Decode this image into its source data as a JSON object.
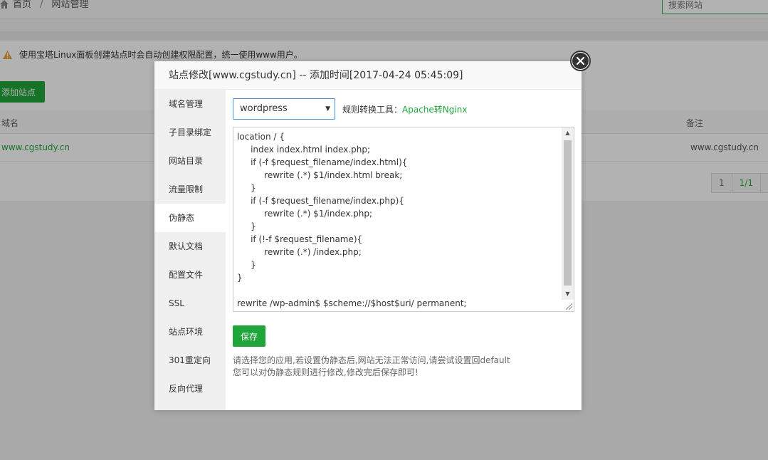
{
  "breadcrumb": {
    "home": "首页",
    "separator": "/",
    "current": "网站管理"
  },
  "search": {
    "placeholder": "搜索网站"
  },
  "alert": {
    "text": "使用宝塔Linux面板创建站点时会自动创建权限配置，统一使用www用户。"
  },
  "toolbar": {
    "add_site_label": "添加站点"
  },
  "table": {
    "columns": [
      "域名",
      "备注"
    ],
    "rows": [
      {
        "domain": "www.cgstudy.cn",
        "remark": "www.cgstudy.cn"
      }
    ]
  },
  "pagination": {
    "page": "1",
    "total": "1/1"
  },
  "modal": {
    "title": "站点修改[www.cgstudy.cn] -- 添加时间[2017-04-24 05:45:09]",
    "sidebar": [
      {
        "label": "域名管理",
        "active": false
      },
      {
        "label": "子目录绑定",
        "active": false
      },
      {
        "label": "网站目录",
        "active": false
      },
      {
        "label": "流量限制",
        "active": false
      },
      {
        "label": "伪静态",
        "active": true
      },
      {
        "label": "默认文档",
        "active": false
      },
      {
        "label": "配置文件",
        "active": false
      },
      {
        "label": "SSL",
        "active": false
      },
      {
        "label": "站点环境",
        "active": false
      },
      {
        "label": "301重定向",
        "active": false
      },
      {
        "label": "反向代理",
        "active": false
      }
    ],
    "rewrite": {
      "selected_rule": "wordpress",
      "tool_label": "规则转换工具：",
      "tool_link": "Apache转Nginx",
      "code": "location / {\n\tindex index.html index.php;\n\tif (-f $request_filename/index.html){\n\t\trewrite (.*) $1/index.html break;\n\t}\n\tif (-f $request_filename/index.php){\n\t\trewrite (.*) $1/index.php;\n\t}\n\tif (!-f $request_filename){\n\t\trewrite (.*) /index.php;\n\t}\n}\n\nrewrite /wp-admin$ $scheme://$host$uri/ permanent;",
      "save_label": "保存",
      "tip_line1": "请选择您的应用,若设置伪静态后,网站无法正常访问,请尝试设置回default",
      "tip_line2": "您可以对伪静态规则进行修改,修改完后保存即可!"
    }
  },
  "colors": {
    "accent": "#20a53a",
    "warning": "#e8a33c",
    "select_border": "#4a8fdc"
  }
}
